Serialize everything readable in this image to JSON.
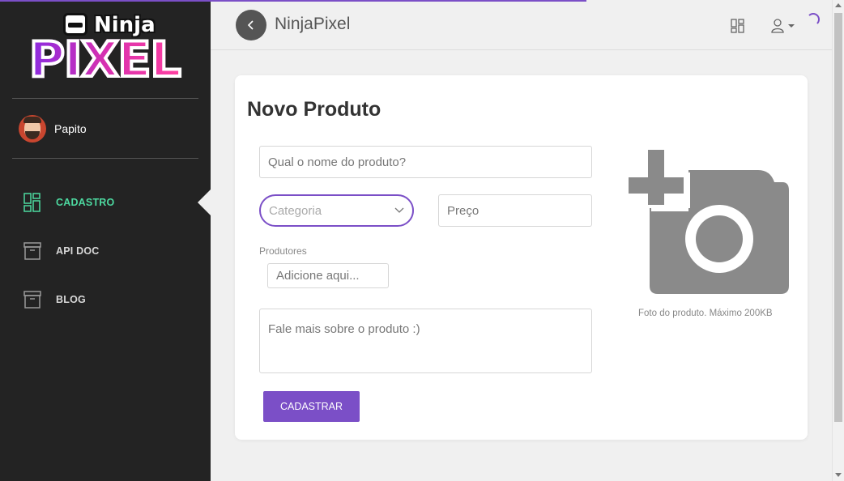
{
  "sidebar": {
    "logo_top": "Ninja",
    "logo_bottom": "PIXEL",
    "user_name": "Papito",
    "items": [
      {
        "label": "CADASTRO",
        "active": true,
        "icon": "dashboard-icon"
      },
      {
        "label": "API DOC",
        "active": false,
        "icon": "archive-box-icon"
      },
      {
        "label": "BLOG",
        "active": false,
        "icon": "archive-box-icon"
      }
    ]
  },
  "header": {
    "title": "NinjaPixel"
  },
  "form": {
    "title": "Novo Produto",
    "nome_placeholder": "Qual o nome do produto?",
    "categoria_placeholder": "Categoria",
    "preco_placeholder": "Preço",
    "produtores_label": "Produtores",
    "produtores_placeholder": "Adicione aqui...",
    "descricao_placeholder": "Fale mais sobre o produto :)",
    "submit_label": "CADASTRAR",
    "photo_hint": "Foto do produto. Máximo 200KB"
  },
  "colors": {
    "accent": "#7b4fc7",
    "active_nav": "#4dd9a0",
    "sidebar_bg": "#232323"
  }
}
